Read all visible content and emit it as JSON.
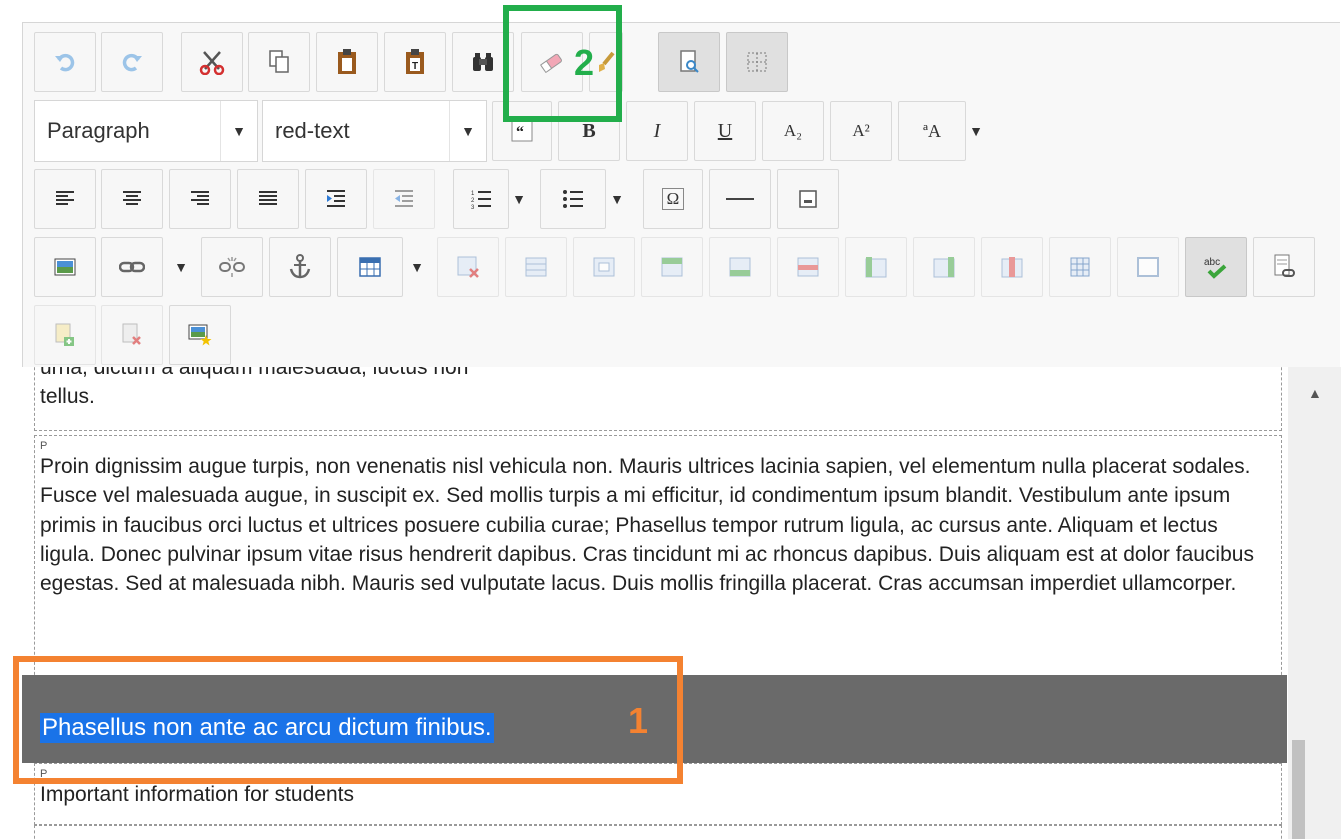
{
  "toolbar": {
    "format_combo": "Paragraph",
    "style_combo": "red-text",
    "buttons": {
      "bold": "B",
      "italic": "I",
      "underline": "U",
      "subscript": "A₂",
      "superscript": "A²",
      "special_char": "Ω",
      "spellcheck": "abc",
      "text_case": "ªA"
    }
  },
  "content": {
    "partial_top_line": "urna, dictum a aliquam malesuada, luctus non",
    "partial_top_tail": "tellus.",
    "block_tag": "P",
    "paragraph_main": "Proin dignissim augue turpis, non venenatis nisl vehicula non. Mauris ultrices lacinia sapien, vel elementum nulla placerat sodales. Fusce vel malesuada augue, in suscipit ex. Sed mollis turpis a mi efficitur, id condimentum ipsum blandit. Vestibulum ante ipsum primis in faucibus orci luctus et ultrices posuere cubilia curae; Phasellus tempor rutrum ligula, ac cursus ante. Aliquam et lectus ligula. Donec pulvinar ipsum vitae risus hendrerit dapibus. Cras tincidunt mi ac rhoncus dapibus. Duis aliquam est at dolor faucibus egestas. Sed at malesuada nibh. Mauris sed vulputate lacus. Duis mollis fringilla placerat. Cras accumsan imperdiet ullamcorper.",
    "selected_paragraph": "Phasellus non ante ac arcu dictum finibus.",
    "next_paragraph": "Important information for students"
  },
  "callouts": {
    "step_one": "1",
    "step_two": "2",
    "orange_color": "#f48231",
    "green_color": "#22ae4b"
  }
}
